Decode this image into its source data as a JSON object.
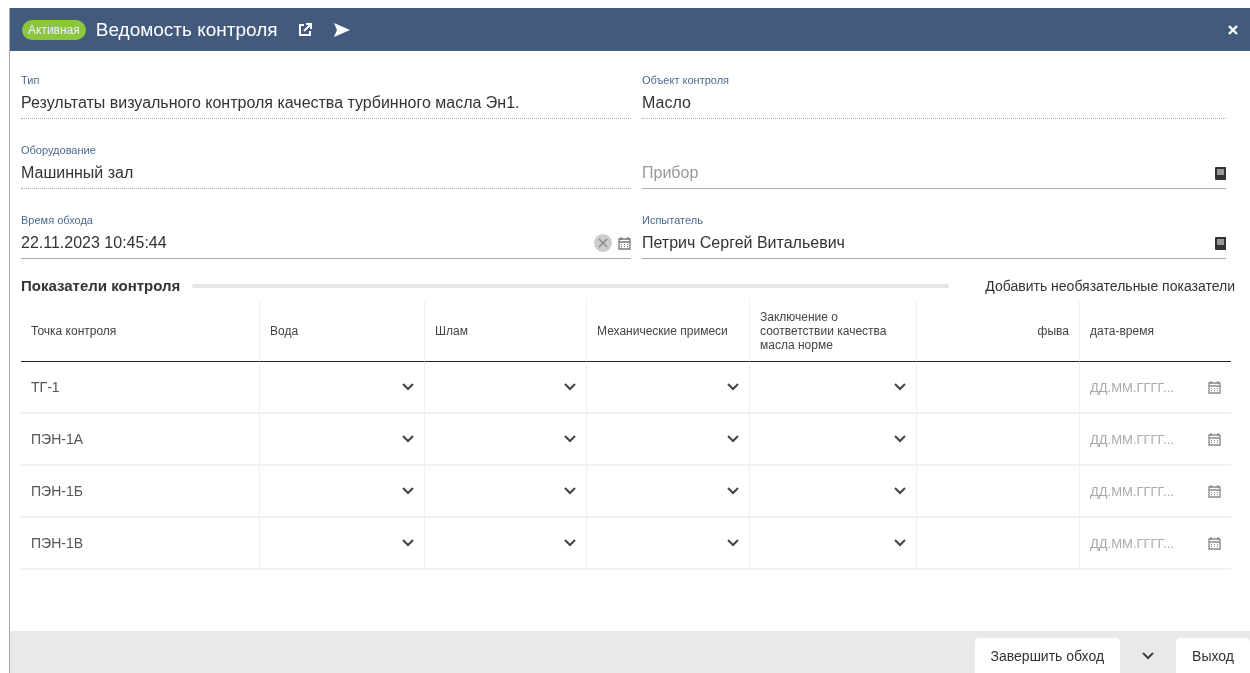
{
  "window": {
    "status": "Активная",
    "title": "Ведомость контроля"
  },
  "fields": [
    {
      "label": "Тип",
      "value": "Результаты визуального контроля качества турбинного масла Эн1.",
      "kind": "text"
    },
    {
      "label": "Объект контроля",
      "value": "Масло",
      "kind": "text"
    },
    {
      "label": "Оборудование",
      "value": "Машинный зал",
      "kind": "text"
    },
    {
      "placeholder": "Прибор",
      "kind": "lookup"
    },
    {
      "label": "Время обхода",
      "value": "22.11.2023 10:45:44",
      "kind": "datetime"
    },
    {
      "label": "Испытатель",
      "value": "Петрич Сергей Витальевич",
      "kind": "lookup"
    }
  ],
  "section": {
    "title": "Показатели контроля",
    "action": "Добавить необязательные показатели"
  },
  "table": {
    "columns": [
      {
        "label": "Точка контроля",
        "kind": "text"
      },
      {
        "label": "Вода",
        "kind": "select"
      },
      {
        "label": "Шлам",
        "kind": "select"
      },
      {
        "label": "Механические примеси",
        "kind": "select"
      },
      {
        "label": "Заключение о соответствии качества масла норме",
        "kind": "select"
      },
      {
        "label": "фыва",
        "kind": "number"
      },
      {
        "label": "дата-время",
        "kind": "date"
      }
    ],
    "rows": [
      {
        "cells": [
          "ТГ-1",
          "",
          "",
          "",
          "",
          "",
          "ДД.ММ.ГГГГ..."
        ]
      },
      {
        "cells": [
          "ПЭН-1А",
          "",
          "",
          "",
          "",
          "",
          "ДД.ММ.ГГГГ..."
        ]
      },
      {
        "cells": [
          "ПЭН-1Б",
          "",
          "",
          "",
          "",
          "",
          "ДД.ММ.ГГГГ..."
        ]
      },
      {
        "cells": [
          "ПЭН-1В",
          "",
          "",
          "",
          "",
          "",
          "ДД.ММ.ГГГГ..."
        ]
      }
    ]
  },
  "footer": {
    "buttons": [
      {
        "label": "Завершить обход",
        "kind": "split"
      },
      {
        "label": "Выход",
        "kind": "plain"
      }
    ]
  }
}
